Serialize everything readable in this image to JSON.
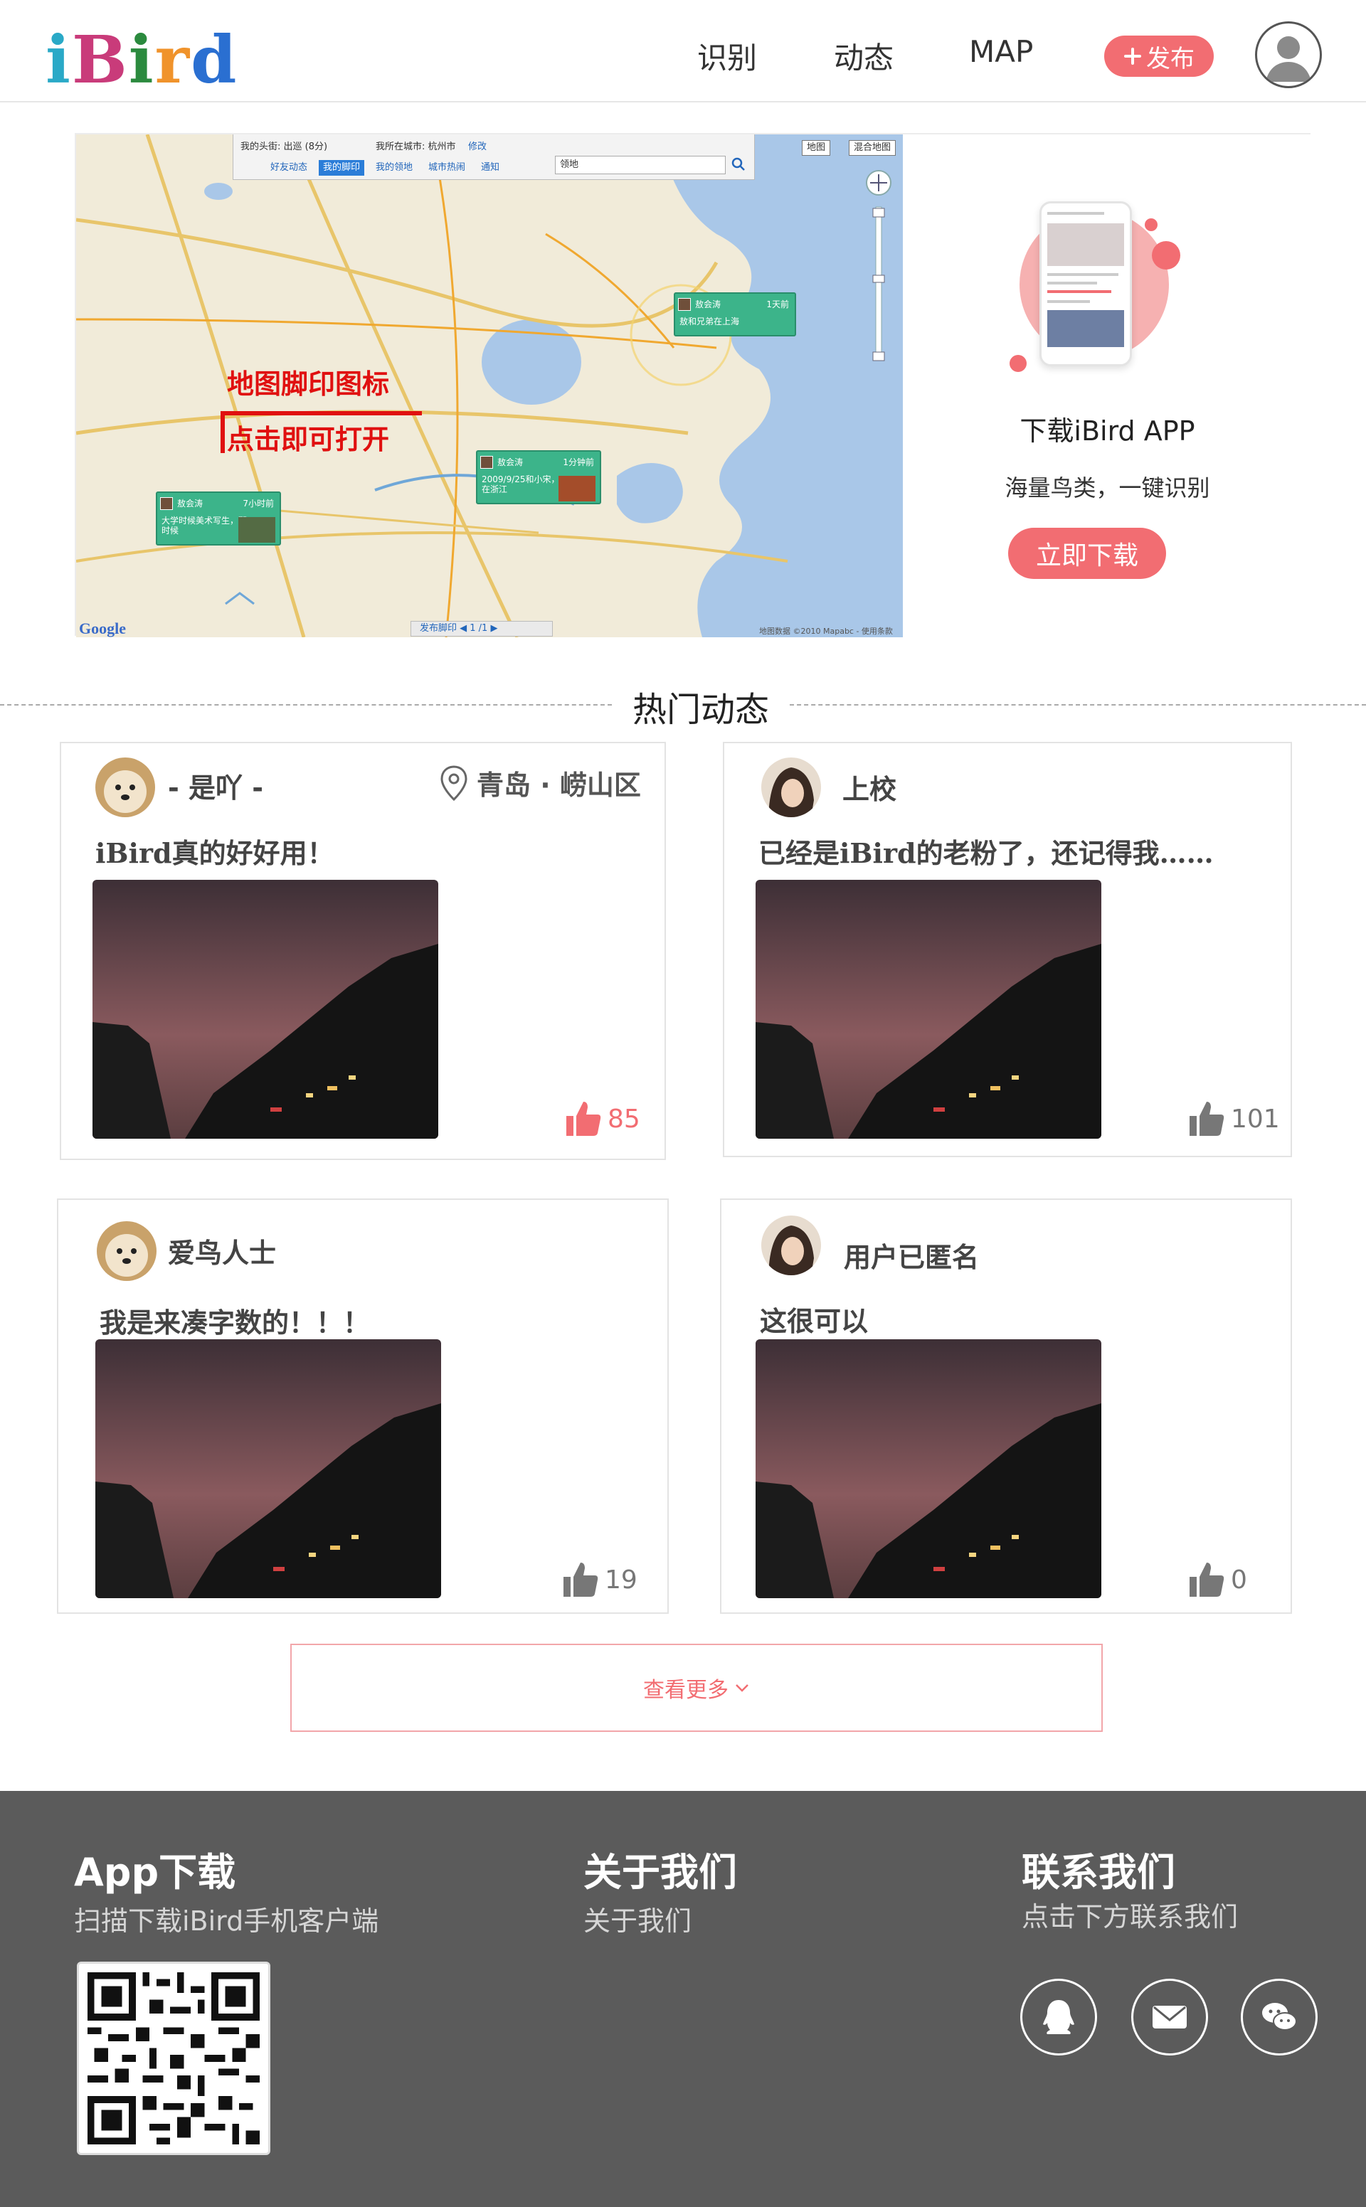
{
  "header": {
    "logo": [
      "i",
      "B",
      "i",
      "r",
      "d"
    ],
    "logo_colors": [
      "#2aa9c7",
      "#c93b7a",
      "#2b8a3e",
      "#f0932b",
      "#2a6fd1"
    ],
    "nav": [
      "识别",
      "动态",
      "MAP"
    ],
    "publish_label": "发布",
    "publish_icon": "plus-icon",
    "avatar_icon": "user-icon"
  },
  "banner": {
    "map": {
      "toolbar": {
        "my_head_label": "我的头街: 出巡 (8分)",
        "city_label": "我所在城市: 杭州市",
        "edit_link": "修改",
        "tabs": [
          "好友动态",
          "我的脚印",
          "我的领地",
          "城市热闹",
          "通知"
        ],
        "active_tab": "我的脚印",
        "search_value": "领地",
        "map_types": [
          "地图",
          "混合地图"
        ]
      },
      "callout_line1": "地图脚印图标",
      "callout_line2": "点击即可打开",
      "markers": [
        {
          "name": "敖会涛",
          "time": "1天前",
          "text": "敖和兄弟在上海"
        },
        {
          "name": "敖会涛",
          "time": "1分钟前",
          "text": "2009/9/25和小宋，在浙江"
        },
        {
          "name": "敖会涛",
          "time": "7小时前",
          "text": "大学时候美术写生，那时候"
        }
      ],
      "pager": "发布脚印  ◀ 1 /1 ▶",
      "copyright": "地图数据 ©2010 Mapabc - 使用条款",
      "google": "Google"
    },
    "promo": {
      "title": "下载iBird APP",
      "subtitle": "海量鸟类，一键识别",
      "button": "立即下载"
    }
  },
  "hot": {
    "title": "热门动态",
    "posts": [
      {
        "user": "- 是吖 -",
        "location": "青岛 · 崂山区",
        "text": "iBird真的好好用！",
        "likes": "85",
        "liked": true,
        "avatar": "dog"
      },
      {
        "user": "上校",
        "location": "",
        "text": "已经是iBird的老粉了，还记得我……",
        "likes": "101",
        "liked": false,
        "avatar": "girl"
      },
      {
        "user": "爱鸟人士",
        "location": "",
        "text": "我是来凑字数的！！！",
        "likes": "19",
        "liked": false,
        "avatar": "dog"
      },
      {
        "user": "用户已匿名",
        "location": "",
        "text": "这很可以",
        "likes": "0",
        "liked": false,
        "avatar": "girl"
      }
    ],
    "more": "查看更多"
  },
  "footer": {
    "app": {
      "title": "App下载",
      "subtitle": "扫描下载iBird手机客户端"
    },
    "about": {
      "title": "关于我们",
      "subtitle": "关于我们"
    },
    "contact": {
      "title": "联系我们",
      "subtitle": "点击下方联系我们"
    },
    "social_icons": [
      "qq-icon",
      "mail-icon",
      "wechat-icon"
    ]
  },
  "colors": {
    "accent": "#f26d72",
    "footer_bg": "#5b5b5b"
  }
}
